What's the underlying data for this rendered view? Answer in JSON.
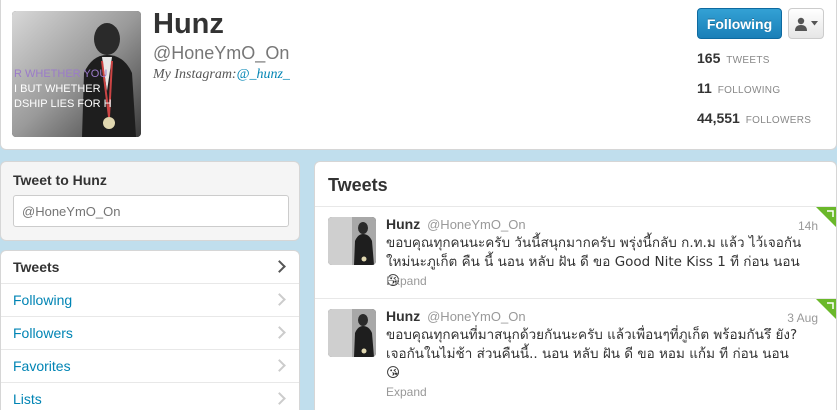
{
  "profile": {
    "display_name": "Hunz",
    "screen_name": "@HoneYmO_On",
    "bio_prefix": "My Instagram:",
    "bio_link": "@_hunz_",
    "avatar_text_lines": [
      "R WHETHER YOU",
      "I BUT WHETHER",
      "DSHIP LIES FOR H"
    ],
    "follow_label": "Following",
    "stats": [
      {
        "num": "165",
        "label": "TWEETS"
      },
      {
        "num": "11",
        "label": "FOLLOWING"
      },
      {
        "num": "44,551",
        "label": "FOLLOWERS"
      }
    ]
  },
  "tweet_to": {
    "title": "Tweet to Hunz",
    "placeholder": "@HoneYmO_On"
  },
  "nav": {
    "items": [
      {
        "label": "Tweets",
        "active": true
      },
      {
        "label": "Following",
        "active": false
      },
      {
        "label": "Followers",
        "active": false
      },
      {
        "label": "Favorites",
        "active": false
      },
      {
        "label": "Lists",
        "active": false
      }
    ]
  },
  "tweets_panel": {
    "title": "Tweets",
    "tweets": [
      {
        "name": "Hunz",
        "screen_name": "@HoneYmO_On",
        "time": "14h",
        "text": "ขอบคุณทุกคนนะครับ วันนี้สนุกมากครับ พรุ่งนี้กลับ ก.ท.ม แล้ว ไว้เจอกันใหม่นะภูเก็ต คืน นี้ นอน หลับ ฝัน ดี ขอ Good Nite Kiss 1 ที ก่อน นอน 😘",
        "expand": "Expand"
      },
      {
        "name": "Hunz",
        "screen_name": "@HoneYmO_On",
        "time": "3 Aug",
        "text": "ขอบคุณทุกคนที่มาสนุกด้วยกันนะครับ แล้วเพื่อนๆที่ภูเก็ต พร้อมกันรึ ยัง? เจอกันในไม่ช้า ส่วนคืนนี้.. นอน หลับ ฝัน ดี ขอ หอม แก้ม ที ก่อน นอน 😘",
        "expand": "Expand"
      }
    ]
  },
  "colors": {
    "background": "#c0deed",
    "link": "#0084b4",
    "follow_button": "#2b90c9",
    "corner_flag": "#6ab82a"
  },
  "icons": {
    "user_dropdown": "person-icon",
    "nav_chevron": "chevron-right-icon",
    "tweet_corner": "green-corner-flag-icon"
  }
}
